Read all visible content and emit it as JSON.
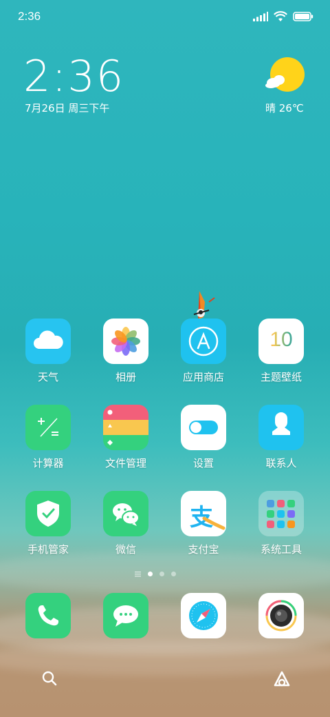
{
  "status_bar": {
    "time": "2:36",
    "icons": [
      "signal-icon",
      "wifi-icon",
      "battery-icon"
    ]
  },
  "widget": {
    "clock": "2:36",
    "date": "7月26日 周三下午",
    "weather": "晴 26℃",
    "weather_icon": "sun-cloud-icon"
  },
  "apps": [
    {
      "label": "天气",
      "icon": "weather-cloud-icon"
    },
    {
      "label": "相册",
      "icon": "photos-flower-icon"
    },
    {
      "label": "应用商店",
      "icon": "app-store-icon"
    },
    {
      "label": "主题壁纸",
      "icon": "themes-icon"
    },
    {
      "label": "计算器",
      "icon": "calculator-icon"
    },
    {
      "label": "文件管理",
      "icon": "file-manager-icon"
    },
    {
      "label": "设置",
      "icon": "settings-toggle-icon"
    },
    {
      "label": "联系人",
      "icon": "contacts-icon"
    },
    {
      "label": "手机管家",
      "icon": "security-shield-icon"
    },
    {
      "label": "微信",
      "icon": "wechat-icon"
    },
    {
      "label": "支付宝",
      "icon": "alipay-icon"
    },
    {
      "label": "系统工具",
      "icon": "system-tools-folder-icon"
    }
  ],
  "themes_icon_text": "10",
  "alipay_glyph": "支",
  "page_indicator": {
    "pages": 3,
    "active": 1
  },
  "dock": [
    {
      "name": "phone",
      "icon": "phone-icon"
    },
    {
      "name": "messages",
      "icon": "message-icon"
    },
    {
      "name": "browser",
      "icon": "compass-icon"
    },
    {
      "name": "camera",
      "icon": "camera-icon"
    }
  ],
  "bottom_bar": {
    "left_icon": "search-icon",
    "right_icon": "assistant-icon"
  },
  "colors": {
    "sky_blue": "#27c4f0",
    "green": "#34d17e",
    "white": "#ffffff",
    "sun": "#ffd31a"
  }
}
